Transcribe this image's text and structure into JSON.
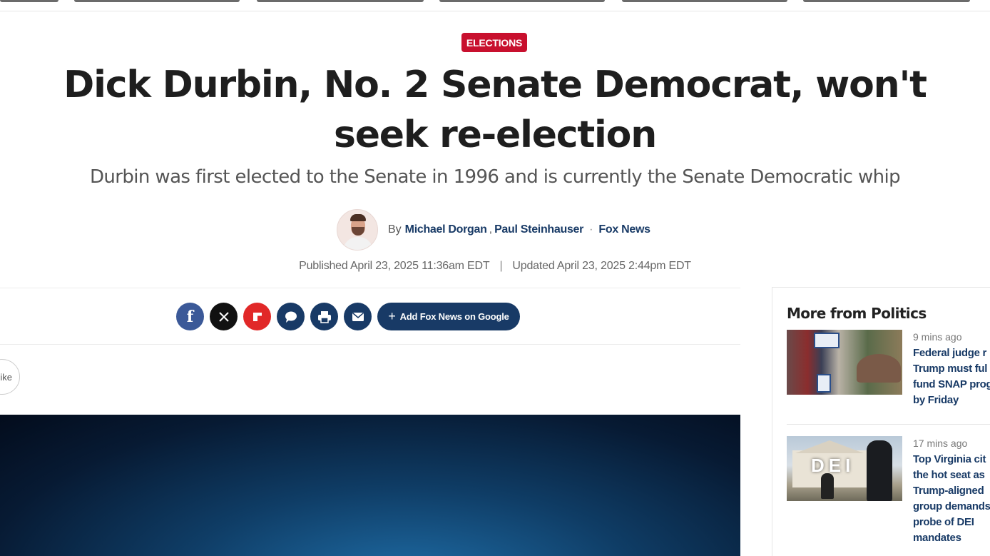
{
  "article": {
    "category": "ELECTIONS",
    "title": "Dick Durbin, No. 2 Senate Democrat, won't seek re-election",
    "subtitle": "Durbin was first elected to the Senate in 1996 and is currently the Senate Democratic whip",
    "byline": {
      "prefix": "By",
      "authors": [
        "Michael Dorgan",
        "Paul Steinhauser"
      ],
      "separator": ",",
      "source": "Fox News"
    },
    "published": "Published April 23, 2025 11:36am EDT",
    "updated": "Updated April 23, 2025 2:44pm EDT",
    "date_separator": "|"
  },
  "share": {
    "icons": [
      "facebook-icon",
      "x-icon",
      "flipboard-icon",
      "comment-icon",
      "print-icon",
      "email-icon"
    ],
    "add_google_label": "Add Fox News on Google",
    "like_label": "ike"
  },
  "sidebar": {
    "title": "More from Politics",
    "stories": [
      {
        "time": "9 mins ago",
        "headline": "Federal judge r\nTrump must ful\nfund SNAP prog\nby Friday",
        "thumb_text": "EBT"
      },
      {
        "time": "17 mins ago",
        "headline": "Top Virginia cit\nthe hot seat as\nTrump-aligned\ngroup demands\nprobe of DEI\nmandates",
        "thumb_text": "DEI"
      }
    ]
  },
  "colors": {
    "brand_red": "#c8102e",
    "link_navy": "#183a66",
    "facebook": "#3b5998",
    "flipboard": "#e12828"
  }
}
